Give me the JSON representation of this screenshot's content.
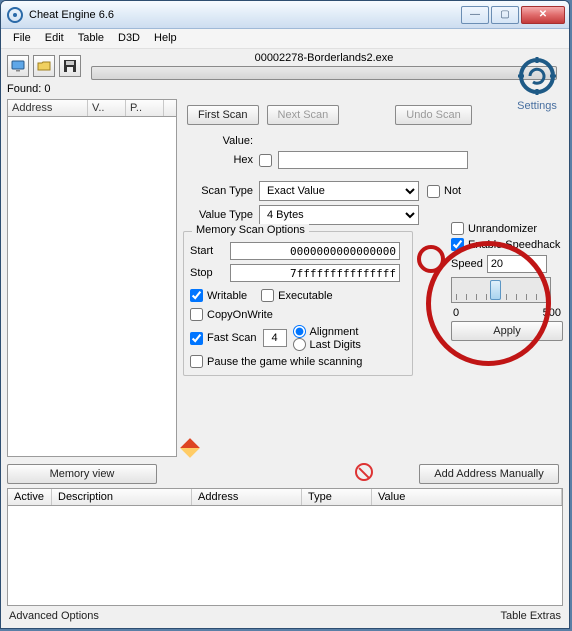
{
  "window": {
    "title": "Cheat Engine 6.6"
  },
  "menu": {
    "file": "File",
    "edit": "Edit",
    "table": "Table",
    "d3d": "D3D",
    "help": "Help"
  },
  "process": {
    "name": "00002278-Borderlands2.exe"
  },
  "logo": {
    "label": "Settings"
  },
  "found": {
    "label": "Found:",
    "count": "0"
  },
  "leftcols": {
    "address": "Address",
    "value": "V..",
    "prev": "P.."
  },
  "buttons": {
    "first_scan": "First Scan",
    "next_scan": "Next Scan",
    "undo_scan": "Undo Scan",
    "memory_view": "Memory view",
    "add_manual": "Add Address Manually",
    "apply": "Apply"
  },
  "labels": {
    "value": "Value:",
    "hex": "Hex",
    "scan_type": "Scan Type",
    "value_type": "Value Type",
    "not": "Not",
    "mem_opts": "Memory Scan Options",
    "start": "Start",
    "stop": "Stop",
    "writable": "Writable",
    "executable": "Executable",
    "copyonwrite": "CopyOnWrite",
    "fast_scan": "Fast Scan",
    "alignment": "Alignment",
    "last_digits": "Last Digits",
    "pause": "Pause the game while scanning",
    "unrandomizer": "Unrandomizer",
    "enable_speedhack": "Enable Speedhack",
    "speed": "Speed"
  },
  "values": {
    "scan_type": "Exact Value",
    "value_type": "4 Bytes",
    "start": "0000000000000000",
    "stop": "7fffffffffffffff",
    "fast_scan": "4",
    "speed": "20",
    "slider_min": "0",
    "slider_max": "500"
  },
  "tablecols": {
    "active": "Active",
    "desc": "Description",
    "address": "Address",
    "type": "Type",
    "value": "Value"
  },
  "footer": {
    "adv": "Advanced Options",
    "extras": "Table Extras"
  }
}
